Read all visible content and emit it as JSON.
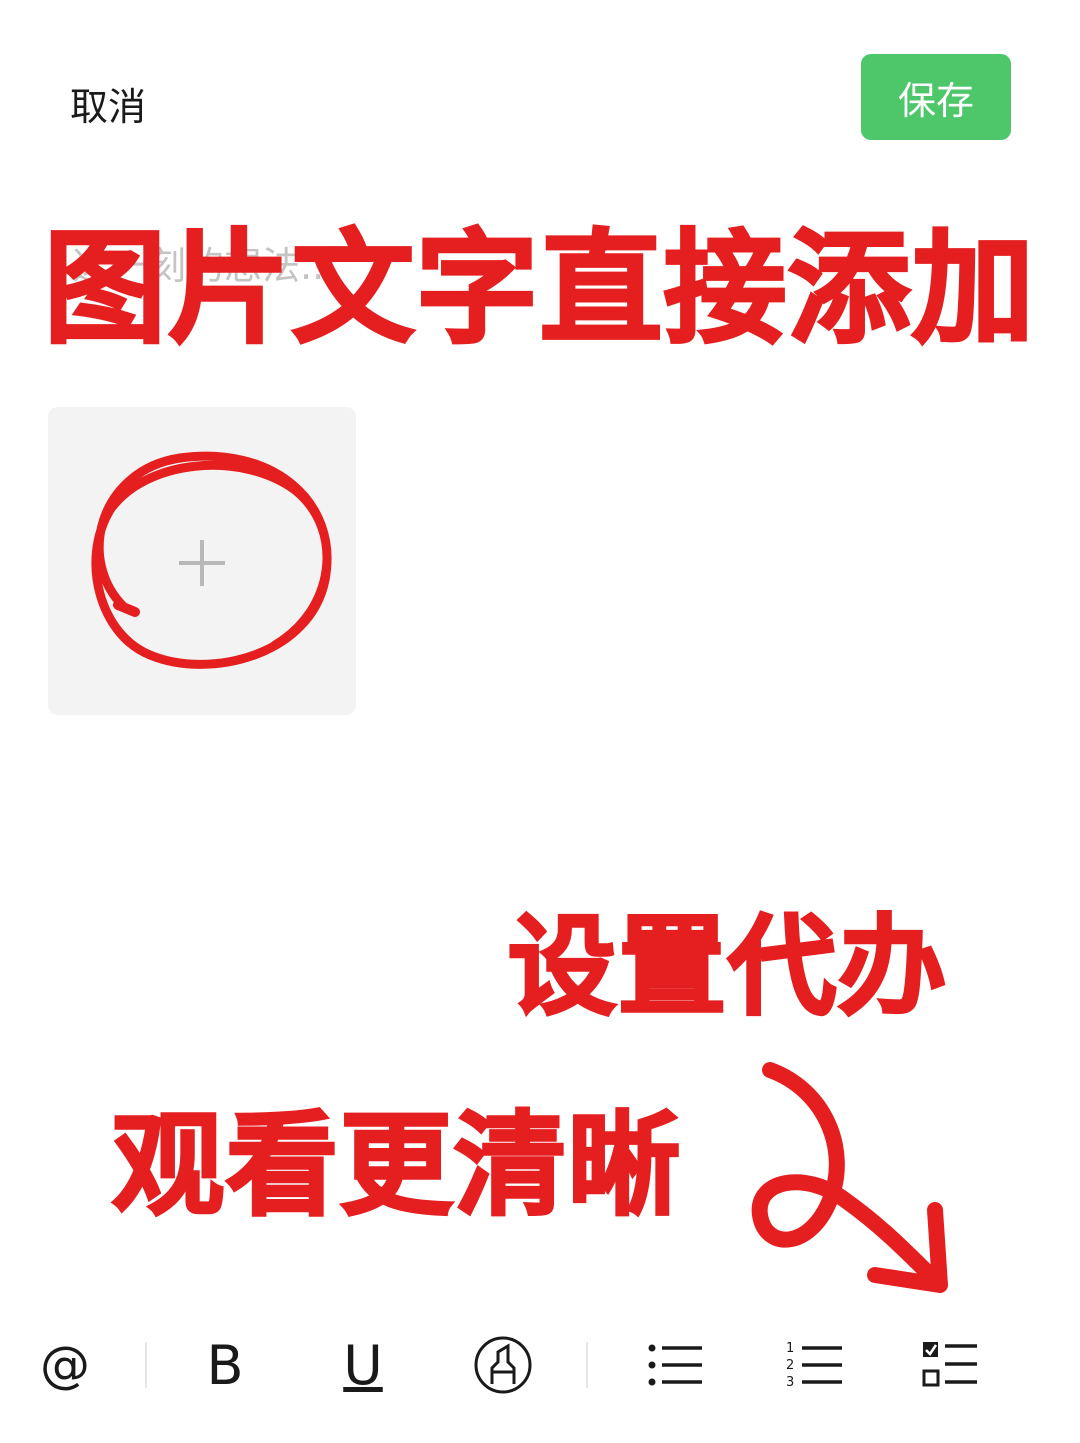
{
  "header": {
    "cancel_label": "取消",
    "save_label": "保存"
  },
  "editor": {
    "placeholder": "这一刻的想法..."
  },
  "annotations": {
    "line1": "图片文字直接添加",
    "line2": "设置代办",
    "line3": "观看更清晰"
  },
  "toolbar": {
    "at_label": "@",
    "bold_label": "B",
    "underline_label": "U"
  },
  "colors": {
    "save_bg": "#4ec66a",
    "annotation_red": "#e51f1f",
    "tile_bg": "#f3f3f3"
  }
}
